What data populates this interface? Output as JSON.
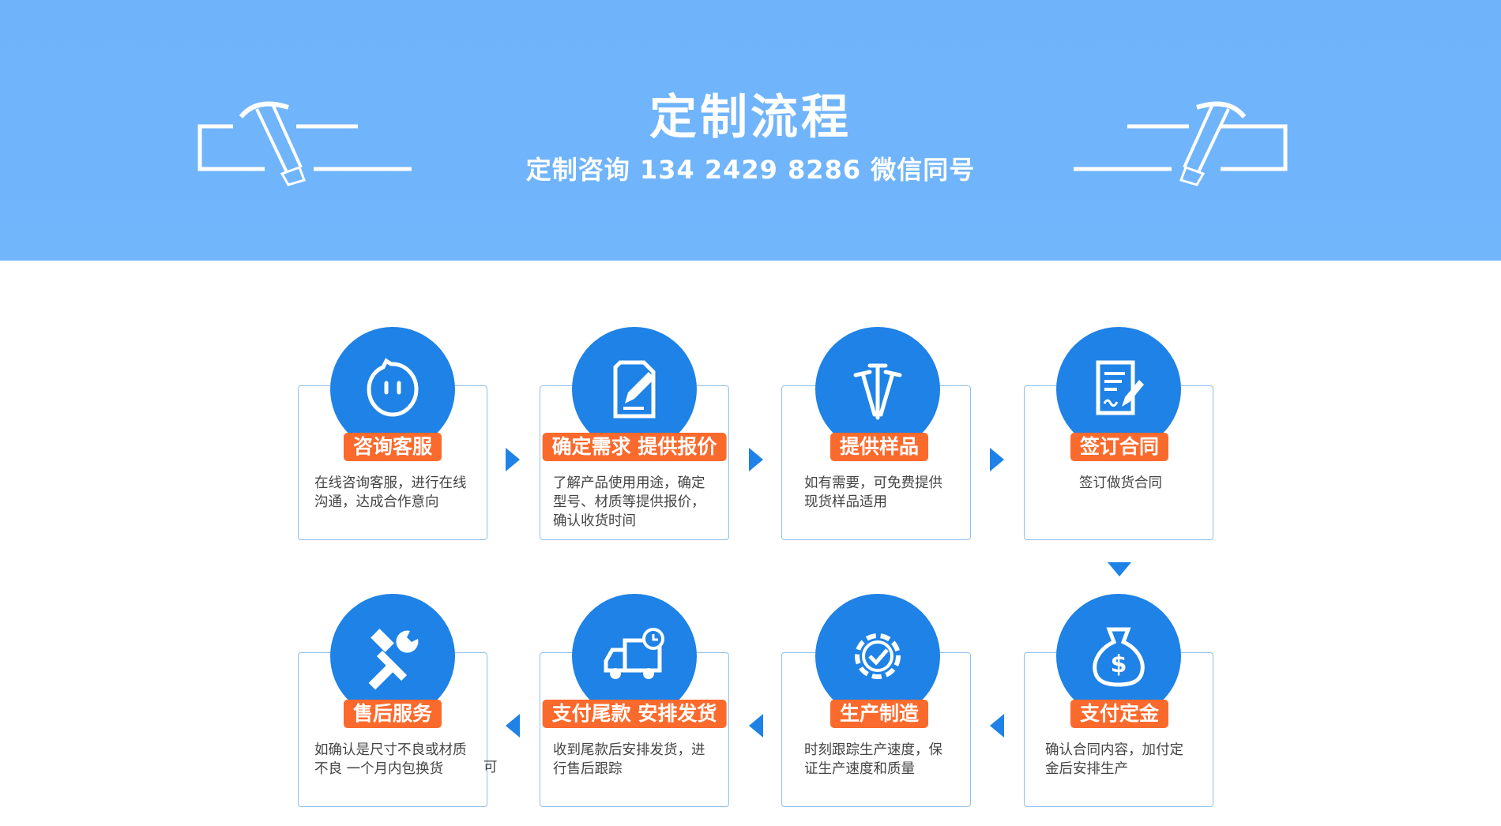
{
  "header": {
    "title": "定制流程",
    "subtitle": "定制咨询 134 2429 8286 微信同号"
  },
  "colors": {
    "banner": "#71b5fb",
    "circle": "#1e82e6",
    "label": "#fb6a2d",
    "card_border": "#8ec0ef",
    "arrow": "#1e82e6"
  },
  "steps": [
    {
      "title": "咨询客服",
      "desc": "在线咨询客服，进行在线\n沟通，达成合作意向",
      "icon": "chat-bubble-icon"
    },
    {
      "title": "确定需求 提供报价",
      "desc": "了解产品使用用途，确定\n型号、材质等提供报价，\n确认收货时间",
      "icon": "document-edit-icon"
    },
    {
      "title": "提供样品",
      "desc": "如有需要，可免费提供\n现货样品适用",
      "icon": "nails-icon"
    },
    {
      "title": "签订合同",
      "desc": "签订做货合同",
      "icon": "contract-sign-icon"
    },
    {
      "title": "支付定金",
      "desc": "确认合同内容，加付定\n金后安排生产",
      "icon": "money-bag-icon"
    },
    {
      "title": "生产制造",
      "desc": "时刻跟踪生产速度，保\n证生产速度和质量",
      "icon": "gear-check-icon"
    },
    {
      "title": "支付尾款 安排发货",
      "desc": "收到尾款后安排发货，进\n行售后跟踪",
      "icon": "delivery-truck-icon"
    },
    {
      "title": "售后服务",
      "desc": "如确认是尺寸不良或材质\n不良    一个月内包换货",
      "extra": "可",
      "icon": "tools-icon"
    }
  ]
}
